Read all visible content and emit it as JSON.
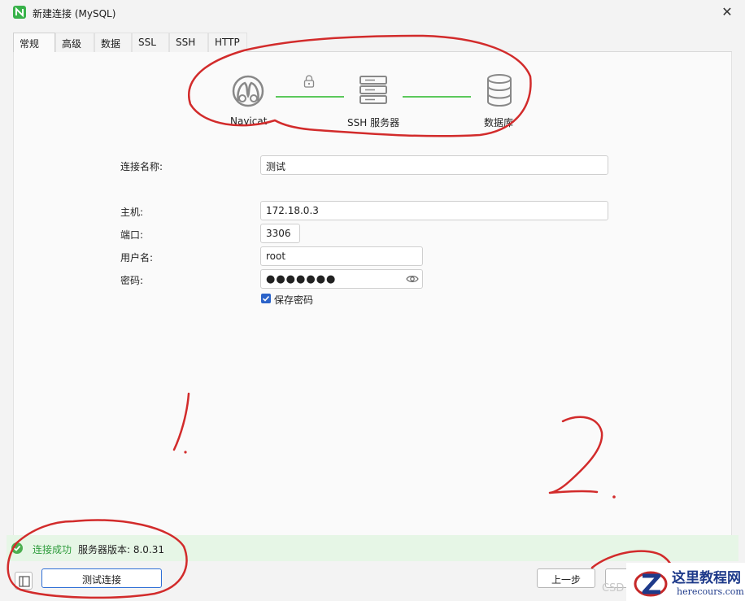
{
  "window": {
    "title": "新建连接 (MySQL)",
    "close_glyph": "✕"
  },
  "tabs": [
    {
      "label": "常规",
      "active": true
    },
    {
      "label": "高级"
    },
    {
      "label": "数据库"
    },
    {
      "label": "SSL"
    },
    {
      "label": "SSH"
    },
    {
      "label": "HTTP"
    }
  ],
  "diagram": {
    "client_label": "Navicat",
    "middle_label": "SSH 服务器",
    "server_label": "数据库",
    "line_color": "#5cc85c",
    "icons": [
      "navicat-icon",
      "lock-icon",
      "server-icon",
      "database-icon"
    ]
  },
  "form": {
    "name_label": "连接名称:",
    "name_value": "测试",
    "host_label": "主机:",
    "host_value": "172.18.0.3",
    "port_label": "端口:",
    "port_value": "3306",
    "user_label": "用户名:",
    "user_value": "root",
    "password_label": "密码:",
    "password_value": "●●●●●●●",
    "save_password_label": "保存密码",
    "save_password_checked": true
  },
  "status": {
    "ok_text": "连接成功",
    "version_text": "服务器版本: 8.0.31",
    "color": "#2e9c3c"
  },
  "buttons": {
    "test_label": "测试连接",
    "prev_label": "上一步"
  },
  "annotations": {
    "mark_1": "1.",
    "mark_2": "2.",
    "color": "#d22b2b"
  },
  "watermark": {
    "cn": "这里教程网",
    "en": "herecours.com",
    "faint": "CSD"
  }
}
